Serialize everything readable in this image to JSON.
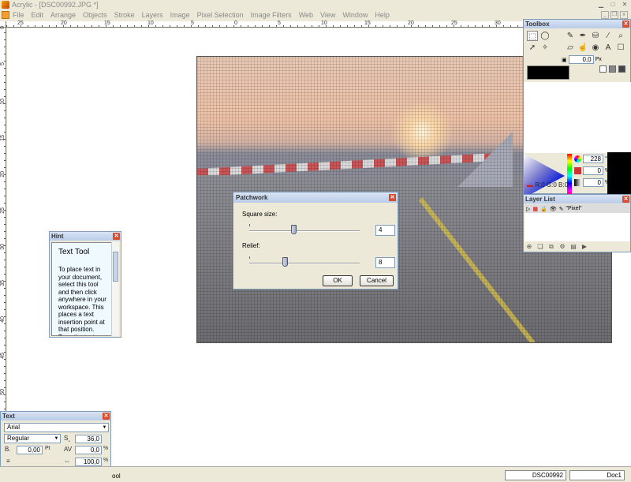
{
  "window": {
    "title": "Acrylic - [DSC00992.JPG *]"
  },
  "menu": [
    "File",
    "Edit",
    "Arrange",
    "Objects",
    "Stroke",
    "Layers",
    "Image",
    "Pixel Selection",
    "Image Filters",
    "Web",
    "View",
    "Window",
    "Help"
  ],
  "ruler": {
    "top_labels": [
      "25",
      "20",
      "15",
      "10",
      "5",
      "0",
      "5",
      "10",
      "15",
      "20",
      "25",
      "30",
      "35"
    ],
    "left_labels": [
      "0",
      "5",
      "10",
      "15",
      "20",
      "25",
      "30",
      "35",
      "40",
      "45",
      "50",
      "55"
    ],
    "corner_label": "cm"
  },
  "toolbox": {
    "title": "Toolbox",
    "size_value": "0,0",
    "size_unit": "Px",
    "hue_value": "228",
    "hue_unit": "°",
    "sat_value": "0",
    "sat_unit": "%",
    "bright_value": "0",
    "bright_unit": "%",
    "rgb": "R:0 G:0 B:0",
    "tool_icons": [
      "marquee-icon",
      "lasso-icon",
      "brush-icon",
      "pen-icon",
      "bucket-icon",
      "clone-icon",
      "eyedropper-icon",
      "zoom-icon",
      "pointer-icon",
      "magic-wand-icon",
      "eraser-icon",
      "blur-icon",
      "smudge-icon",
      "dodge-icon",
      "type-icon",
      "hand-icon"
    ]
  },
  "layers": {
    "title": "Layer List",
    "layer_name": "\"Pixel\""
  },
  "dialog": {
    "title": "Patchwork",
    "square_label": "Square size:",
    "square_value": "4",
    "square_fraction": 0.4,
    "relief_label": "Relief:",
    "relief_value": "8",
    "relief_fraction": 0.32,
    "ok": "OK",
    "cancel": "Cancel"
  },
  "hint": {
    "title": "Hint",
    "heading": "Text Tool",
    "body": "To place text in your document, select this tool and then click anywhere in your workspace. This places a text insertion point at that position. Type the text (press"
  },
  "text_palette": {
    "title": "Text",
    "font": "Arial",
    "style": "Regular",
    "size": "36,0",
    "baseline": "0,00",
    "baseline_unit": "Pt",
    "tracking": "0,0",
    "tracking_unit": "%",
    "scale": "100,0",
    "scale_unit": "%"
  },
  "status": {
    "left": "ool",
    "filename": "DSC00992",
    "doc": "Doc1"
  }
}
